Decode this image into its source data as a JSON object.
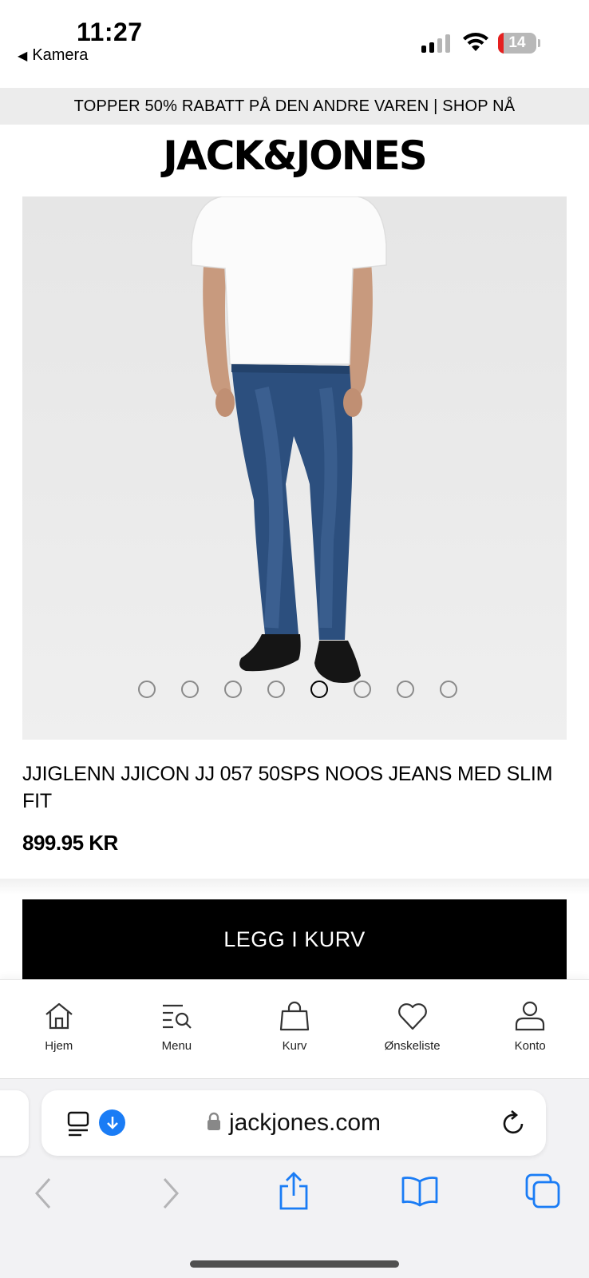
{
  "status_bar": {
    "time": "11:27",
    "back_label": "Kamera",
    "battery_level": "14",
    "battery_fraction": 0.14,
    "signal_bars_active": 2,
    "signal_bars_total": 4
  },
  "promo": {
    "text": "TOPPER 50% RABATT PÅ DEN ANDRE VAREN | SHOP NÅ"
  },
  "brand": {
    "logo_text": "JACK&JONES"
  },
  "product": {
    "title": "JJIGLENN JJICON JJ 057 50SPS NOOS JEANS MED SLIM FIT",
    "price": "899.95 KR",
    "image_count": 8,
    "active_image_index": 4,
    "add_to_cart_label": "LEGG I KURV"
  },
  "bottom_nav": {
    "items": [
      {
        "label": "Hjem",
        "icon": "home-icon"
      },
      {
        "label": "Menu",
        "icon": "menu-search-icon"
      },
      {
        "label": "Kurv",
        "icon": "bag-icon"
      },
      {
        "label": "Ønskeliste",
        "icon": "heart-icon"
      },
      {
        "label": "Konto",
        "icon": "user-icon"
      }
    ]
  },
  "browser": {
    "url": "jackjones.com",
    "accent_color": "#1a7cf5",
    "toolbar_icons": [
      "back-icon",
      "forward-icon",
      "share-icon",
      "bookmarks-icon",
      "tabs-icon"
    ]
  }
}
